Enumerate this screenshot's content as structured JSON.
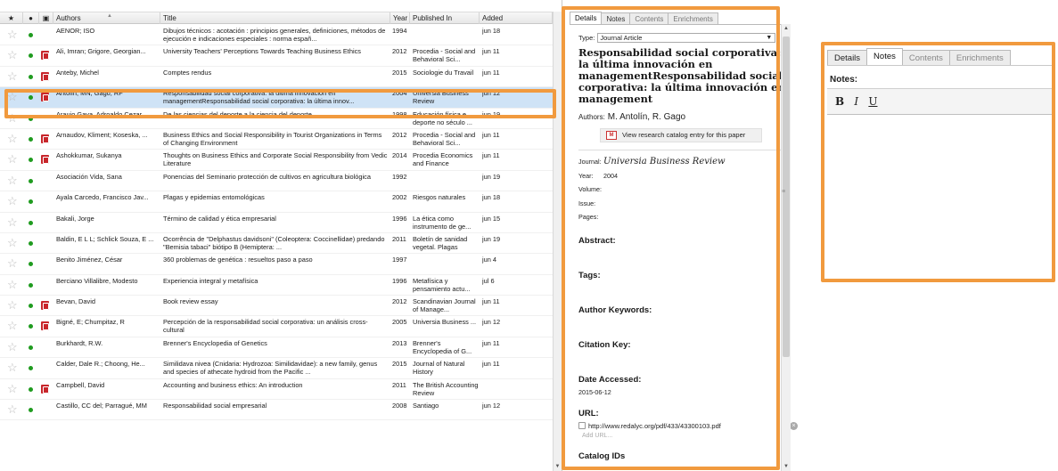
{
  "columns": {
    "star": "★",
    "read": "●",
    "attach": "▣",
    "authors": "Authors",
    "title": "Title",
    "year": "Year",
    "published_in": "Published In",
    "added": "Added"
  },
  "rows": [
    {
      "authors": "AENOR; ISO",
      "title": "Dibujos técnicos : acotación : principios generales, definiciones, métodos de ejecución e indicaciones especiales : norma españ...",
      "year": "1994",
      "published_in": "",
      "added": "jun 18",
      "pdf": false,
      "selected": false
    },
    {
      "authors": "Ali, Imran; Grigore, Georgian...",
      "title": "University Teachers' Perceptions Towards Teaching Business Ethics",
      "year": "2012",
      "published_in": "Procedia - Social and Behavioral Sci...",
      "added": "jun 11",
      "pdf": true,
      "selected": false
    },
    {
      "authors": "Anteby, Michel",
      "title": "Comptes rendus",
      "year": "2015",
      "published_in": "Sociologie du Travail",
      "added": "jun 11",
      "pdf": true,
      "selected": false
    },
    {
      "authors": "Antolín, MN; Gago, RF",
      "title": "Responsabilidad social corporativa: la última innovación en managementResponsabilidad social corporativa: la última innov...",
      "year": "2004",
      "published_in": "Universia Business Review",
      "added": "jun 12",
      "pdf": true,
      "selected": true
    },
    {
      "authors": "Araujo Gaya, Adroaldo Cezar",
      "title": "De las ciencias del deporte a la ciencia del deporte",
      "year": "1998",
      "published_in": "Educación física e deporte no século ...",
      "added": "jun 19",
      "pdf": false,
      "selected": false
    },
    {
      "authors": "Arnaudov, Kliment; Koseska, ...",
      "title": "Business Ethics and Social Responsibility in Tourist Organizations in Terms of Changing Environment",
      "year": "2012",
      "published_in": "Procedia - Social and Behavioral Sci...",
      "added": "jun 11",
      "pdf": true,
      "selected": false
    },
    {
      "authors": "Ashokkumar, Sukanya",
      "title": "Thoughts on Business Ethics and Corporate Social Responsibility from Vedic Literature",
      "year": "2014",
      "published_in": "Procedia Economics and Finance",
      "added": "jun 11",
      "pdf": true,
      "selected": false
    },
    {
      "authors": "Asociación Vida, Sana",
      "title": "Ponencias del Seminario protección de cultivos en agricultura biológica",
      "year": "1992",
      "published_in": "",
      "added": "jun 19",
      "pdf": false,
      "selected": false
    },
    {
      "authors": "Ayala Carcedo, Francisco Jav...",
      "title": "Plagas y epidemias entomológicas",
      "year": "2002",
      "published_in": "Riesgos naturales",
      "added": "jun 18",
      "pdf": false,
      "selected": false
    },
    {
      "authors": "Bakali, Jorge",
      "title": "Término de calidad y ética empresarial",
      "year": "1996",
      "published_in": "La ética como instrumento de ge...",
      "added": "jun 15",
      "pdf": false,
      "selected": false
    },
    {
      "authors": "Baldin, E L L; Schlick Souza, E ...",
      "title": "Ocorrência de \"Delphastus davidsoni\" (Coleoptera: Coccinellidae) predando \"Bemisia tabaci\" biótipo B (Hemiptera: ...",
      "year": "2011",
      "published_in": "Boletín de sanidad vegetal. Plagas",
      "added": "jun 19",
      "pdf": false,
      "selected": false
    },
    {
      "authors": "Benito Jiménez, César",
      "title": "360 problemas de genética : resueltos paso a paso",
      "year": "1997",
      "published_in": "",
      "added": "jun 4",
      "pdf": false,
      "selected": false
    },
    {
      "authors": "Berciano Villalibre, Modesto",
      "title": "Experiencia integral y metafísica",
      "year": "1996",
      "published_in": "Metafísica y pensamiento actu...",
      "added": "jul 6",
      "pdf": false,
      "selected": false
    },
    {
      "authors": "Bevan, David",
      "title": "Book review essay",
      "year": "2012",
      "published_in": "Scandinavian Journal of Manage...",
      "added": "jun 11",
      "pdf": true,
      "selected": false
    },
    {
      "authors": "Bigné, E; Chumpitaz, R",
      "title": "Percepción de la responsabilidad social corporativa: un análisis cross-cultural",
      "year": "2005",
      "published_in": "Universia Business ...",
      "added": "jun 12",
      "pdf": true,
      "selected": false
    },
    {
      "authors": "Burkhardt, R.W.",
      "title": "Brenner's Encyclopedia of Genetics",
      "year": "2013",
      "published_in": "Brenner's Encyclopedia of G...",
      "added": "jun 11",
      "pdf": false,
      "selected": false
    },
    {
      "authors": "Calder, Dale R.; Choong, He...",
      "title": "Similidava nivea (Cnidaria: Hydrozoa: Similidavidae): a new family, genus and species of athecate hydroid from the Pacific ...",
      "year": "2015",
      "published_in": "Journal of Natural History",
      "added": "jun 11",
      "pdf": false,
      "selected": false
    },
    {
      "authors": "Campbell, David",
      "title": "Accounting and business ethics: An introduction",
      "year": "2011",
      "published_in": "The British Accounting Review",
      "added": "",
      "pdf": true,
      "selected": false
    },
    {
      "authors": "Castillo, CC del; Parragué, MM",
      "title": "Responsabilidad social empresarial",
      "year": "2008",
      "published_in": "Santiago",
      "added": "jun 12",
      "pdf": false,
      "selected": false
    }
  ],
  "details": {
    "tabs": [
      "Details",
      "Notes",
      "Contents",
      "Enrichments"
    ],
    "type_label": "Type:",
    "type_value": "Journal Article",
    "title": "Responsabilidad social corporativa: la última innovación en managementResponsabilidad social corporativa: la última innovación en management",
    "authors_label": "Authors:",
    "authors_value": "M. Antolín, R. Gago",
    "catalog_button": "View research catalog entry for this paper",
    "journal_label": "Journal:",
    "journal_value": "Universia Business Review",
    "year_label": "Year:",
    "year_value": "2004",
    "volume_label": "Volume:",
    "issue_label": "Issue:",
    "pages_label": "Pages:",
    "abstract_label": "Abstract:",
    "tags_label": "Tags:",
    "author_keywords_label": "Author Keywords:",
    "citation_key_label": "Citation Key:",
    "date_accessed_label": "Date Accessed:",
    "date_accessed_value": "2015-06-12",
    "url_label": "URL:",
    "url_value": "http://www.redalyc.org/pdf/433/43300103.pdf",
    "add_url": "Add URL...",
    "catalog_ids_label": "Catalog IDs"
  },
  "notes_panel": {
    "tabs": [
      "Details",
      "Notes",
      "Contents",
      "Enrichments"
    ],
    "label": "Notes:",
    "bold": "B",
    "italic": "I",
    "underline": "U"
  },
  "colors": {
    "highlight": "#f19a3e",
    "selected_row": "#cfe3f6",
    "read_dot": "#1f9b1f",
    "pdf_icon": "#c8262b"
  }
}
